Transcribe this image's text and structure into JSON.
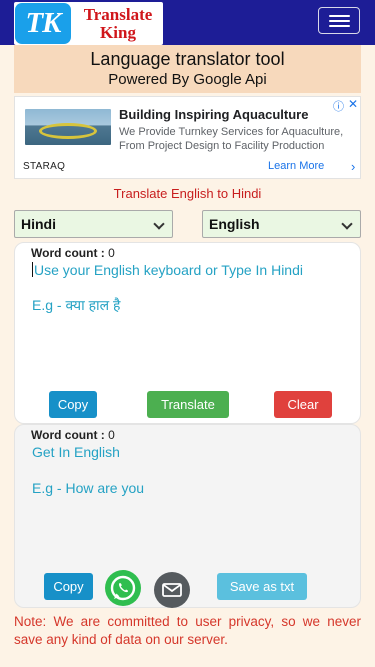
{
  "navbar": {
    "logo_mark": "TK",
    "logo_text_line1": "Translate",
    "logo_text_line2": "King"
  },
  "header": {
    "title": "Language translator tool",
    "subtitle": "Powered By Google Api"
  },
  "ad": {
    "title": "Building Inspiring Aquaculture",
    "description": "We Provide Turnkey Services for Aquaculture, From Project Design to Facility Production",
    "brand": "STARAQ",
    "cta": "Learn More"
  },
  "translate_direction": "Translate English to Hindi",
  "languages": {
    "source": "Hindi",
    "target": "English"
  },
  "input_panel": {
    "word_count_label": "Word count :",
    "word_count_value": "0",
    "placeholder": "Use your English keyboard or Type In Hindi",
    "example": "E.g - क्या हाल है",
    "copy_label": "Copy",
    "translate_label": "Translate",
    "clear_label": "Clear"
  },
  "output_panel": {
    "word_count_label": "Word count :",
    "word_count_value": "0",
    "placeholder": "Get In English",
    "example": "E.g - How are you",
    "copy_label": "Copy",
    "save_label": "Save as txt"
  },
  "note": "Note: We are committed to user privacy, so we never save any kind of data on our server.",
  "icons": [
    "menu-icon",
    "info-icon",
    "close-icon",
    "chevron-right-icon",
    "chevron-down-icon",
    "whatsapp-icon",
    "mail-icon"
  ]
}
